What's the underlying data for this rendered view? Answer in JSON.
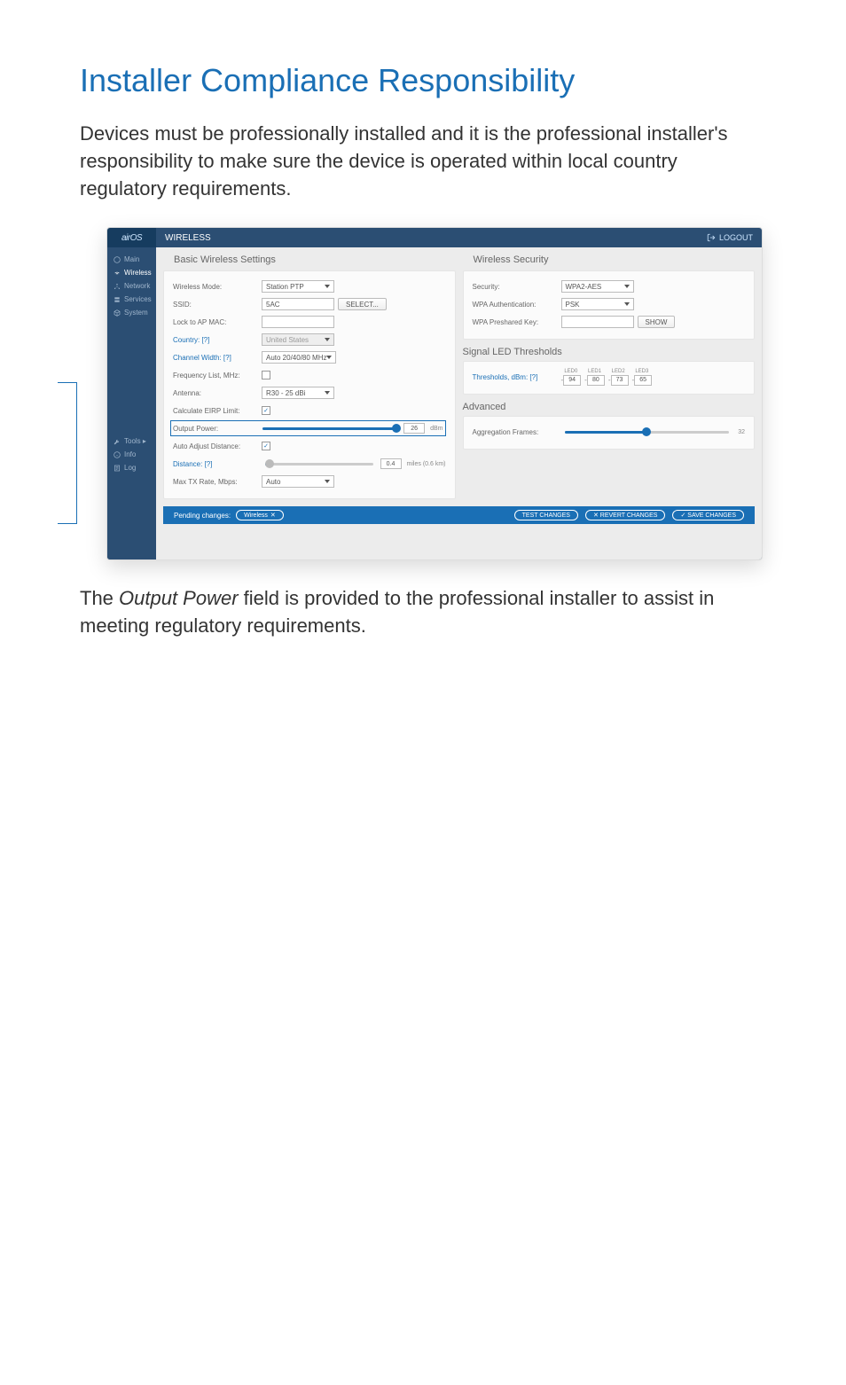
{
  "document": {
    "title": "Installer Compliance Responsibility",
    "intro": "Devices must be professionally installed and it is the professional installer's responsibility to make sure the device is operated within local country regulatory requirements.",
    "outro_pre": "The ",
    "outro_em": "Output Power",
    "outro_post": " field is provided to the professional installer to assist in meeting regulatory requirements."
  },
  "ui": {
    "brand": "airOS",
    "header_title": "WIRELESS",
    "logout": "LOGOUT",
    "sidebar": [
      {
        "icon": "gauge",
        "label": "Main"
      },
      {
        "icon": "wifi",
        "label": "Wireless",
        "active": true
      },
      {
        "icon": "network",
        "label": "Network"
      },
      {
        "icon": "services",
        "label": "Services"
      },
      {
        "icon": "cube",
        "label": "System"
      }
    ],
    "sidebar_bottom": [
      {
        "icon": "wrench",
        "label": "Tools ▸"
      },
      {
        "icon": "info",
        "label": "Info"
      },
      {
        "icon": "log",
        "label": "Log"
      }
    ],
    "left_panel": {
      "title": "Basic Wireless Settings",
      "rows": {
        "wireless_mode": {
          "label": "Wireless Mode:",
          "value": "Station PTP"
        },
        "ssid": {
          "label": "SSID:",
          "value": "5AC",
          "btn": "SELECT..."
        },
        "lock_ap_mac": {
          "label": "Lock to AP MAC:",
          "value": ""
        },
        "country": {
          "label": "Country: [?]",
          "value": "United States"
        },
        "channel_width": {
          "label": "Channel Width: [?]",
          "value": "Auto 20/40/80 MHz"
        },
        "freq_list": {
          "label": "Frequency List, MHz:",
          "checked": false
        },
        "antenna": {
          "label": "Antenna:",
          "value": "R30 - 25 dBi"
        },
        "calc_eirp": {
          "label": "Calculate EIRP Limit:",
          "checked": true
        },
        "output_power": {
          "label": "Output Power:",
          "value": "26",
          "unit": "dBm"
        },
        "auto_adjust": {
          "label": "Auto Adjust Distance:",
          "checked": true
        },
        "distance": {
          "label": "Distance: [?]",
          "value": "0.4",
          "unit": "miles (0.6 km)"
        },
        "max_tx": {
          "label": "Max TX Rate, Mbps:",
          "value": "Auto"
        }
      }
    },
    "right_panel": {
      "security": {
        "title": "Wireless Security",
        "rows": {
          "security": {
            "label": "Security:",
            "value": "WPA2-AES"
          },
          "wpa_auth": {
            "label": "WPA Authentication:",
            "value": "PSK"
          },
          "wpa_key": {
            "label": "WPA Preshared Key:",
            "value": "",
            "btn": "SHOW"
          }
        }
      },
      "led": {
        "title": "Signal LED Thresholds",
        "label": "Thresholds, dBm: [?]",
        "leds": [
          {
            "name": "LED0",
            "val": "94"
          },
          {
            "name": "LED1",
            "val": "80"
          },
          {
            "name": "LED2",
            "val": "73"
          },
          {
            "name": "LED3",
            "val": "65"
          }
        ]
      },
      "advanced": {
        "title": "Advanced",
        "agg": {
          "label": "Aggregation Frames:",
          "value": "32"
        }
      }
    },
    "pending": {
      "label": "Pending changes:",
      "chip": "Wireless",
      "buttons": {
        "test": "TEST CHANGES",
        "revert": "✕ REVERT CHANGES",
        "save": "✓ SAVE CHANGES"
      }
    }
  }
}
